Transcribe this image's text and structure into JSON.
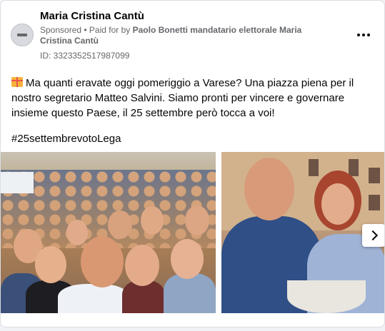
{
  "post": {
    "page_name": "Maria Cristina Cantù",
    "sponsored": "Sponsored",
    "separator": " • ",
    "paid_for_prefix": "Paid for by ",
    "paid_for_by": "Paolo Bonetti mandatario elettorale Maria Cristina Cantù",
    "ad_id": "ID: 3323352517987099",
    "text": "Ma quanti eravate oggi pomeriggio a Varese? Una piazza piena per il nostro segretario Matteo Salvini. Siamo pronti per vincere e governare insieme questo Paese, il 25 settembre però tocca a voi!",
    "hashtag": "#25settembrevotoLega",
    "emoji_icon": "gift-icon"
  },
  "icons": {
    "avatar": "blocked-avatar-icon",
    "more": "more-horizontal-icon",
    "next": "chevron-right-icon"
  },
  "colors": {
    "text": "#050505",
    "secondary": "#65676b",
    "card_bg": "#ffffff",
    "page_bg": "#f0f2f5"
  }
}
